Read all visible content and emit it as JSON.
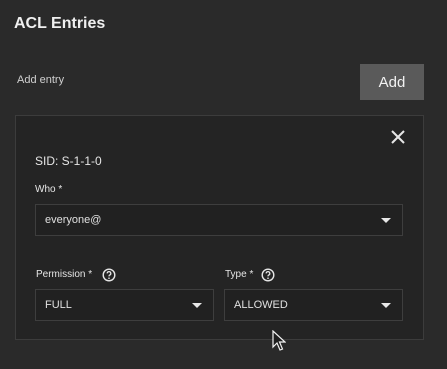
{
  "header": {
    "title": "ACL Entries"
  },
  "add_entry": {
    "label": "Add entry",
    "button_label": "Add"
  },
  "entry": {
    "sid": "SID: S-1-1-0",
    "who": {
      "label": "Who *",
      "value": "everyone@"
    },
    "permission": {
      "label": "Permission *",
      "value": "FULL"
    },
    "type": {
      "label": "Type *",
      "value": "ALLOWED"
    }
  },
  "icons": {
    "close": "close-icon",
    "help": "help-circle-icon",
    "dropdown": "chevron-down-icon",
    "cursor": "mouse-pointer-icon"
  },
  "colors": {
    "background": "#2a2a2a",
    "card": "#242424",
    "button": "#5a5a5a"
  }
}
